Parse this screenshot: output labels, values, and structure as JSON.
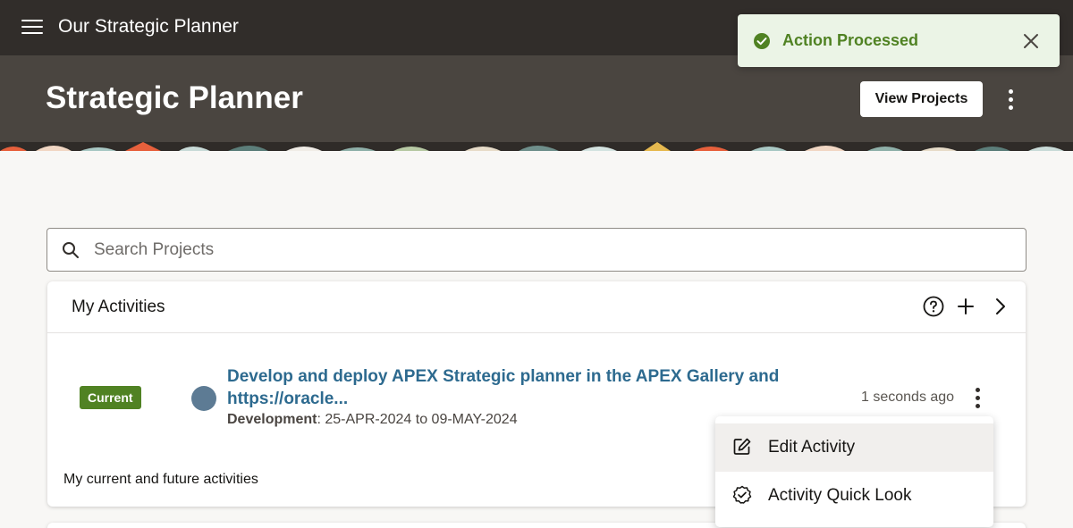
{
  "app": {
    "title": "Our Strategic Planner"
  },
  "hero": {
    "title": "Strategic Planner",
    "view_projects_label": "View Projects"
  },
  "toast": {
    "message": "Action Processed",
    "color": "#508223"
  },
  "search": {
    "placeholder": "Search Projects",
    "value": ""
  },
  "activities": {
    "title": "My Activities",
    "footer": "My current and future activities",
    "items": [
      {
        "status": "Current",
        "title": "Develop and deploy APEX Strategic planner in the APEX Gallery and https://oracle...",
        "phase": "Development",
        "dates": ": 25-APR-2024 to 09-MAY-2024",
        "time_ago": "1 seconds ago"
      }
    ]
  },
  "menu": {
    "items": [
      {
        "label": "Edit Activity",
        "icon": "edit-icon"
      },
      {
        "label": "Activity Quick Look",
        "icon": "badge-check-icon"
      }
    ]
  },
  "colors": {
    "header": "#312d2a",
    "hero": "#4a4540",
    "link": "#2d6a8f",
    "badge": "#508223"
  }
}
